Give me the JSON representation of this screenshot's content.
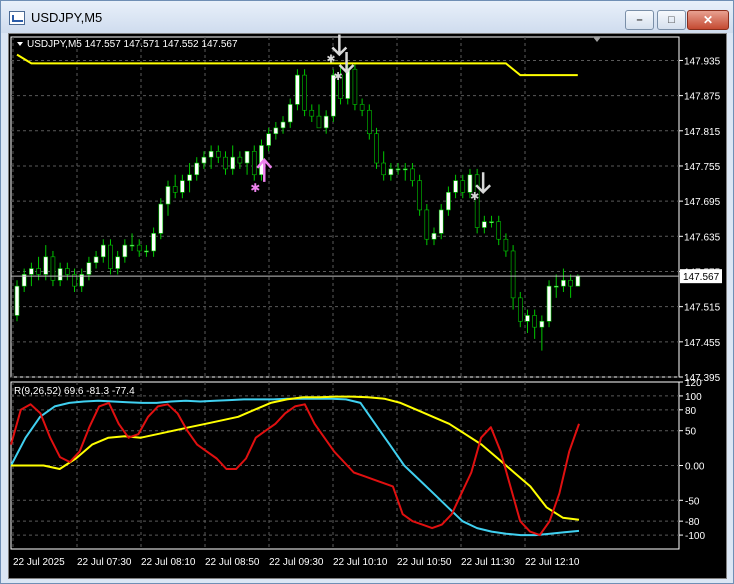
{
  "window": {
    "title": "USDJPY,M5",
    "minimize_glyph": "–",
    "maximize_glyph": "□",
    "close_glyph": "✕"
  },
  "colors": {
    "background": "#000000",
    "grid": "#5a5a5a",
    "bull_candle": "#ffffff",
    "bear_candle": "#ffffff",
    "wick": "#00c800",
    "price_line": "#ffff00",
    "rsi_fast": "#e01010",
    "rsi_mid": "#40d0f0",
    "rsi_slow": "#ffff00",
    "buy_arrow": "#ee82ee",
    "sell_arrow": "#d8d8d8"
  },
  "main_chart": {
    "header": "USDJPY,M5  147.557 147.571 147.552 147.567",
    "price_ticks": [
      "147.935",
      "147.875",
      "147.815",
      "147.755",
      "147.695",
      "147.635",
      "147.575",
      "147.515",
      "147.455",
      "147.395"
    ],
    "current_price": "147.567",
    "symbol_icon": "triangle-down-icon"
  },
  "indicator": {
    "header": "R(9,26,52) 69.6 -81.3 -77.4",
    "ticks": [
      "120",
      "100",
      "80",
      "50",
      "0.00",
      "-50",
      "-80",
      "-100"
    ]
  },
  "time_axis": [
    "22 Jul 2025",
    "22 Jul 07:30",
    "22 Jul 08:10",
    "22 Jul 08:50",
    "22 Jul 09:30",
    "22 Jul 10:10",
    "22 Jul 10:50",
    "22 Jul 11:30",
    "22 Jul 12:10"
  ],
  "chart_data": {
    "type": "candlestick",
    "candles": [
      [
        147.5,
        147.56,
        147.49,
        147.55
      ],
      [
        147.55,
        147.58,
        147.54,
        147.57
      ],
      [
        147.57,
        147.59,
        147.55,
        147.58
      ],
      [
        147.58,
        147.6,
        147.56,
        147.57
      ],
      [
        147.57,
        147.62,
        147.56,
        147.6
      ],
      [
        147.6,
        147.61,
        147.55,
        147.56
      ],
      [
        147.56,
        147.59,
        147.55,
        147.58
      ],
      [
        147.58,
        147.59,
        147.56,
        147.57
      ],
      [
        147.57,
        147.58,
        147.54,
        147.55
      ],
      [
        147.55,
        147.58,
        147.54,
        147.57
      ],
      [
        147.57,
        147.6,
        147.56,
        147.59
      ],
      [
        147.59,
        147.61,
        147.58,
        147.6
      ],
      [
        147.6,
        147.63,
        147.59,
        147.62
      ],
      [
        147.62,
        147.63,
        147.57,
        147.58
      ],
      [
        147.58,
        147.61,
        147.57,
        147.6
      ],
      [
        147.6,
        147.63,
        147.59,
        147.62
      ],
      [
        147.62,
        147.64,
        147.61,
        147.62
      ],
      [
        147.62,
        147.63,
        147.6,
        147.61
      ],
      [
        147.61,
        147.62,
        147.6,
        147.61
      ],
      [
        147.61,
        147.65,
        147.6,
        147.64
      ],
      [
        147.64,
        147.7,
        147.63,
        147.69
      ],
      [
        147.69,
        147.73,
        147.67,
        147.72
      ],
      [
        147.72,
        147.74,
        147.7,
        147.71
      ],
      [
        147.71,
        147.74,
        147.7,
        147.73
      ],
      [
        147.73,
        147.76,
        147.71,
        147.74
      ],
      [
        147.74,
        147.77,
        147.73,
        147.76
      ],
      [
        147.76,
        147.78,
        147.75,
        147.77
      ],
      [
        147.77,
        147.79,
        147.75,
        147.78
      ],
      [
        147.78,
        147.79,
        147.76,
        147.77
      ],
      [
        147.77,
        147.78,
        147.74,
        147.75
      ],
      [
        147.75,
        147.79,
        147.74,
        147.77
      ],
      [
        147.77,
        147.78,
        147.75,
        147.76
      ],
      [
        147.76,
        147.78,
        147.74,
        147.78
      ],
      [
        147.78,
        147.79,
        147.73,
        147.74
      ],
      [
        147.74,
        147.8,
        147.73,
        147.79
      ],
      [
        147.79,
        147.82,
        147.78,
        147.81
      ],
      [
        147.81,
        147.83,
        147.8,
        147.82
      ],
      [
        147.82,
        147.84,
        147.81,
        147.83
      ],
      [
        147.83,
        147.87,
        147.82,
        147.86
      ],
      [
        147.86,
        147.92,
        147.85,
        147.91
      ],
      [
        147.91,
        147.92,
        147.84,
        147.85
      ],
      [
        147.85,
        147.86,
        147.83,
        147.84
      ],
      [
        147.84,
        147.86,
        147.82,
        147.82
      ],
      [
        147.82,
        147.85,
        147.81,
        147.84
      ],
      [
        147.84,
        147.92,
        147.83,
        147.91
      ],
      [
        147.91,
        147.93,
        147.86,
        147.87
      ],
      [
        147.87,
        147.93,
        147.86,
        147.92
      ],
      [
        147.92,
        147.93,
        147.85,
        147.86
      ],
      [
        147.86,
        147.87,
        147.84,
        147.85
      ],
      [
        147.85,
        147.86,
        147.8,
        147.81
      ],
      [
        147.81,
        147.82,
        147.75,
        147.76
      ],
      [
        147.76,
        147.78,
        147.73,
        147.74
      ],
      [
        147.74,
        147.76,
        147.73,
        147.75
      ],
      [
        147.75,
        147.76,
        147.74,
        147.75
      ],
      [
        147.75,
        147.76,
        147.73,
        147.75
      ],
      [
        147.75,
        147.76,
        147.72,
        147.73
      ],
      [
        147.73,
        147.74,
        147.67,
        147.68
      ],
      [
        147.68,
        147.69,
        147.62,
        147.63
      ],
      [
        147.63,
        147.65,
        147.62,
        147.64
      ],
      [
        147.64,
        147.69,
        147.63,
        147.68
      ],
      [
        147.68,
        147.72,
        147.67,
        147.71
      ],
      [
        147.71,
        147.74,
        147.7,
        147.73
      ],
      [
        147.73,
        147.74,
        147.7,
        147.71
      ],
      [
        147.71,
        147.75,
        147.7,
        147.74
      ],
      [
        147.74,
        147.75,
        147.64,
        147.65
      ],
      [
        147.65,
        147.67,
        147.64,
        147.66
      ],
      [
        147.66,
        147.67,
        147.65,
        147.66
      ],
      [
        147.66,
        147.67,
        147.62,
        147.63
      ],
      [
        147.63,
        147.64,
        147.6,
        147.61
      ],
      [
        147.61,
        147.62,
        147.51,
        147.53
      ],
      [
        147.53,
        147.54,
        147.48,
        147.49
      ],
      [
        147.49,
        147.51,
        147.47,
        147.5
      ],
      [
        147.5,
        147.51,
        147.46,
        147.48
      ],
      [
        147.48,
        147.5,
        147.44,
        147.49
      ],
      [
        147.49,
        147.56,
        147.48,
        147.55
      ],
      [
        147.55,
        147.57,
        147.53,
        147.55
      ],
      [
        147.55,
        147.58,
        147.54,
        147.56
      ],
      [
        147.56,
        147.57,
        147.53,
        147.55
      ],
      [
        147.55,
        147.57,
        147.55,
        147.567
      ]
    ],
    "price_line": [
      [
        0,
        147.945
      ],
      [
        2,
        147.93
      ],
      [
        68,
        147.93
      ],
      [
        70,
        147.91
      ],
      [
        78,
        147.91
      ]
    ],
    "signals": [
      {
        "i": 33,
        "type": "buy",
        "price": 147.745
      },
      {
        "i": 44,
        "type": "sell",
        "price": 147.935
      },
      {
        "i": 45,
        "type": "sell",
        "price": 147.905
      },
      {
        "i": 64,
        "type": "sell",
        "price": 147.7
      }
    ],
    "price_range": [
      147.395,
      147.975
    ],
    "indicator_range": [
      -120,
      120
    ],
    "rsi_red": [
      30,
      80,
      88,
      75,
      40,
      12,
      5,
      20,
      55,
      85,
      90,
      60,
      40,
      45,
      70,
      85,
      88,
      75,
      50,
      30,
      20,
      10,
      -5,
      -5,
      10,
      40,
      50,
      60,
      75,
      85,
      88,
      60,
      40,
      20,
      5,
      -10,
      -15,
      -20,
      -25,
      -30,
      -70,
      -80,
      -85,
      -90,
      -85,
      -70,
      -40,
      -10,
      40,
      55,
      20,
      -30,
      -80,
      -95,
      -100,
      -80,
      -40,
      20,
      60
    ],
    "rsi_cyan": [
      0,
      40,
      70,
      85,
      90,
      92,
      93,
      92,
      91,
      90,
      90,
      92,
      93,
      92,
      93,
      94,
      95,
      95,
      95,
      96,
      96,
      96,
      96,
      95,
      90,
      60,
      30,
      0,
      -20,
      -40,
      -60,
      -80,
      -90,
      -95,
      -98,
      -100,
      -100,
      -98,
      -96,
      -94
    ],
    "rsi_yellow": [
      0,
      0,
      0,
      -5,
      10,
      30,
      40,
      42,
      40,
      45,
      50,
      55,
      60,
      65,
      70,
      80,
      90,
      95,
      98,
      98,
      99,
      99,
      98,
      96,
      90,
      80,
      70,
      60,
      45,
      30,
      10,
      -10,
      -30,
      -60,
      -75,
      -78
    ]
  }
}
